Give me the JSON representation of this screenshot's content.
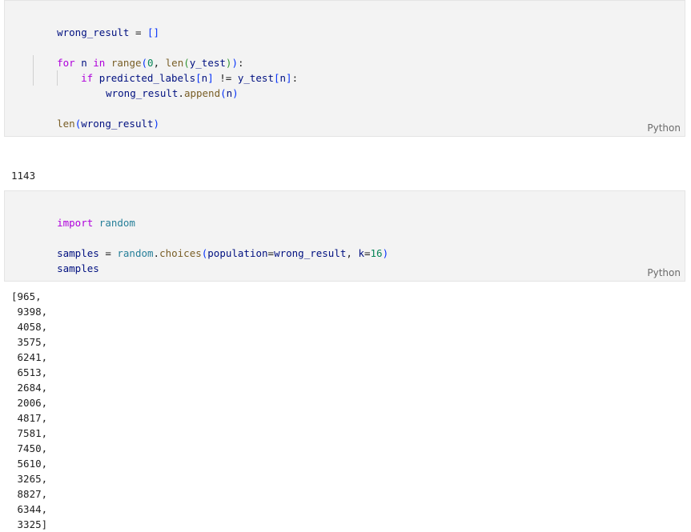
{
  "cells": [
    {
      "language": "Python",
      "output": "1143"
    },
    {
      "language": "Python",
      "output_open": "[",
      "output_values": [
        "965",
        "9398",
        "4058",
        "3575",
        "6241",
        "6513",
        "2684",
        "2006",
        "4817",
        "7581",
        "7450",
        "5610",
        "3265",
        "8827",
        "6344",
        "3325"
      ],
      "output_close": "]"
    }
  ],
  "tokens": {
    "wrong_result": "wrong_result",
    "assign": " = ",
    "empty_list": "[]",
    "for": "for",
    "n": "n",
    "in": "in",
    "range": "range",
    "zero": "0",
    "comma_space": ", ",
    "len": "len",
    "y_test": "y_test",
    "if": "if",
    "predicted_labels": "predicted_labels",
    "ne": " != ",
    "colon": ":",
    "dot": ".",
    "append": "append",
    "import": "import",
    "random": "random",
    "samples": "samples",
    "choices": "choices",
    "population": "population",
    "eq": "=",
    "k": "k",
    "sixteen": "16",
    "lparen": "(",
    "rparen": ")",
    "lbrack": "[",
    "rbrack": "]",
    "space": " "
  }
}
